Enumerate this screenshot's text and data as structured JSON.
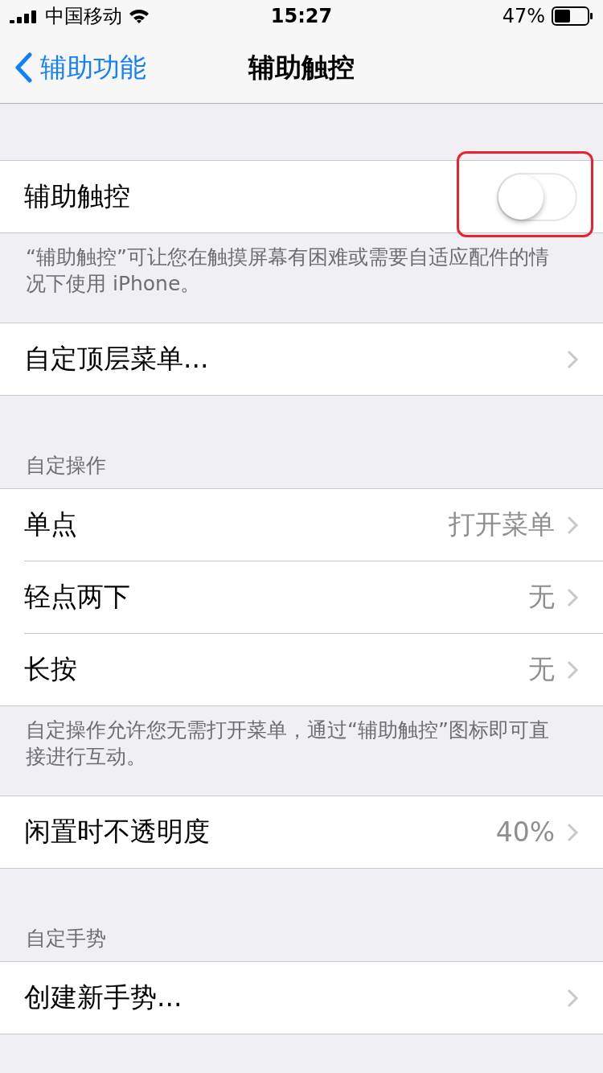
{
  "status_bar": {
    "carrier": "中国移动",
    "time": "15:27",
    "battery": "47%"
  },
  "nav": {
    "back_label": "辅助功能",
    "title": "辅助触控"
  },
  "sections": [
    {
      "rows": [
        {
          "kind": "toggle",
          "label": "辅助触控",
          "on": false
        }
      ],
      "footer": "“辅助触控”可让您在触摸屏幕有困难或需要自适应配件的情况下使用 iPhone。"
    },
    {
      "rows": [
        {
          "kind": "link",
          "label": "自定顶层菜单..."
        }
      ]
    },
    {
      "header": "自定操作",
      "rows": [
        {
          "kind": "link",
          "label": "单点",
          "value": "打开菜单"
        },
        {
          "kind": "link",
          "label": "轻点两下",
          "value": "无"
        },
        {
          "kind": "link",
          "label": "长按",
          "value": "无"
        }
      ],
      "footer": "自定操作允许您无需打开菜单，通过“辅助触控”图标即可直接进行互动。"
    },
    {
      "rows": [
        {
          "kind": "link",
          "label": "闲置时不透明度",
          "value": "40%"
        }
      ]
    },
    {
      "header": "自定手势",
      "rows": [
        {
          "kind": "link",
          "label": "创建新手势..."
        }
      ]
    }
  ]
}
